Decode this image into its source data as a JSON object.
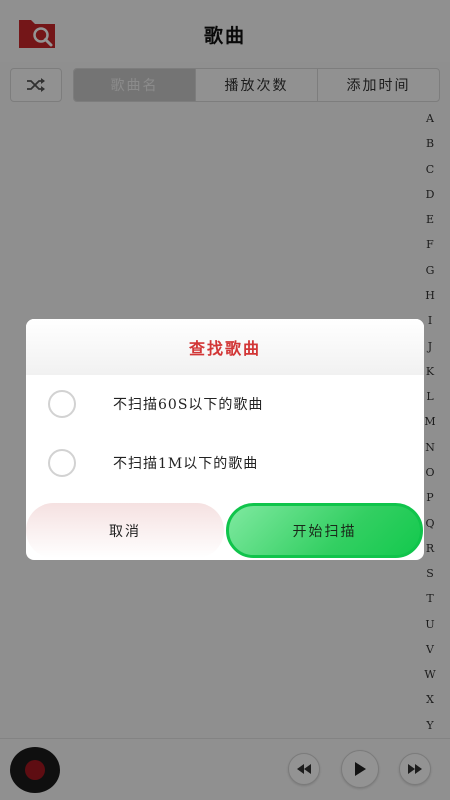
{
  "header": {
    "title": "歌曲",
    "search_folder_icon": "folder-search-icon"
  },
  "toolbar": {
    "shuffle_icon": "shuffle-icon",
    "tabs": [
      {
        "label": "歌曲名",
        "active": true
      },
      {
        "label": "播放次数",
        "active": false
      },
      {
        "label": "添加时间",
        "active": false
      }
    ]
  },
  "alpha_index": [
    "A",
    "B",
    "C",
    "D",
    "E",
    "F",
    "G",
    "H",
    "I",
    "J",
    "K",
    "L",
    "M",
    "N",
    "O",
    "P",
    "Q",
    "R",
    "S",
    "T",
    "U",
    "V",
    "W",
    "X",
    "Y"
  ],
  "player": {
    "disc_icon": "vinyl-disc-icon",
    "prev_icon": "rewind-icon",
    "play_icon": "play-icon",
    "next_icon": "fast-forward-icon"
  },
  "dialog": {
    "title": "查找歌曲",
    "options": [
      {
        "label": "不扫描60S以下的歌曲",
        "checked": false
      },
      {
        "label": "不扫描1M以下的歌曲",
        "checked": false
      }
    ],
    "cancel_label": "取消",
    "start_label": "开始扫描"
  },
  "colors": {
    "title_red": "#d23636",
    "start_green": "#13c94d",
    "folder_red": "#c8262a"
  }
}
